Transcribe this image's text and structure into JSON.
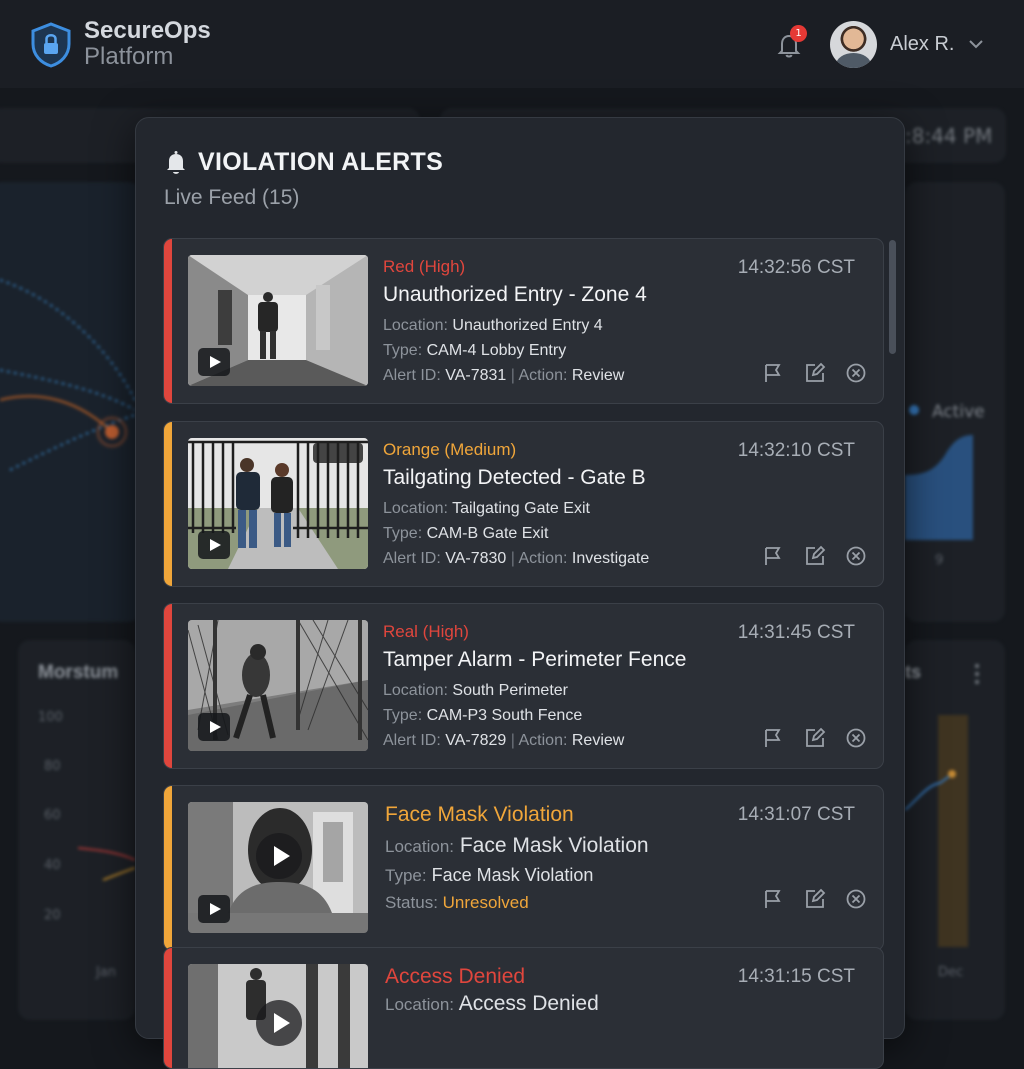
{
  "header": {
    "brand_line1": "SecureOps",
    "brand_line2": "Platform",
    "notification_count": "1",
    "user_name": "Alex R."
  },
  "background": {
    "clock_fragment": ":8:44 PM",
    "legend_active": "Active",
    "chart_title_fragment": "Morstum",
    "right_title_fragment": "ts",
    "y_ticks": [
      "100",
      "80",
      "60",
      "40",
      "20"
    ],
    "month_start": "Jan",
    "month_end": "Dec",
    "small_tick": "9"
  },
  "panel": {
    "title": "VIOLATION ALERTS",
    "subtitle": "Live Feed (15)"
  },
  "colors": {
    "high": "#e0463d",
    "medium": "#f0a63a",
    "background": "#15181d",
    "card": "#2b2f36"
  },
  "alerts": [
    {
      "severity": "Red (High)",
      "title": "Unauthorized Entry - Zone 4",
      "time": "14:32:56 CST",
      "location_label": "Location:",
      "location": "Unauthorized Entry 4",
      "type_label": "Type:",
      "type": "CAM-4 Lobby Entry",
      "id_label": "Alert ID:",
      "alert_id": "VA-7831",
      "action_label": "Action:",
      "action": "Review"
    },
    {
      "severity": "Orange (Medium)",
      "title": "Tailgating Detected - Gate B",
      "time": "14:32:10 CST",
      "location_label": "Location:",
      "location": "Tailgating Gate Exit",
      "type_label": "Type:",
      "type": "CAM-B Gate Exit",
      "id_label": "Alert ID:",
      "alert_id": "VA-7830",
      "action_label": "Action:",
      "action": "Investigate"
    },
    {
      "severity": "Real (High)",
      "title": "Tamper Alarm - Perimeter Fence",
      "time": "14:31:45 CST",
      "location_label": "Location:",
      "location": "South Perimeter",
      "type_label": "Type:",
      "type": "CAM-P3 South Fence",
      "id_label": "Alert ID:",
      "alert_id": "VA-7829",
      "action_label": "Action:",
      "action": "Review"
    },
    {
      "title": "Face Mask Violation",
      "time": "14:31:07 CST",
      "location_label": "Location:",
      "location": "Face Mask Violation",
      "type_label": "Type:",
      "type": "Face Mask Violation",
      "status_label": "Status:",
      "status": "Unresolved"
    },
    {
      "title": "Access Denied",
      "time": "14:31:15 CST",
      "location_label": "Location:",
      "location": "Access Denied"
    }
  ],
  "icons": [
    "shield-lock-icon",
    "bell-icon",
    "chevron-down-icon",
    "play-icon",
    "flag-icon",
    "edit-icon",
    "dismiss-icon"
  ]
}
